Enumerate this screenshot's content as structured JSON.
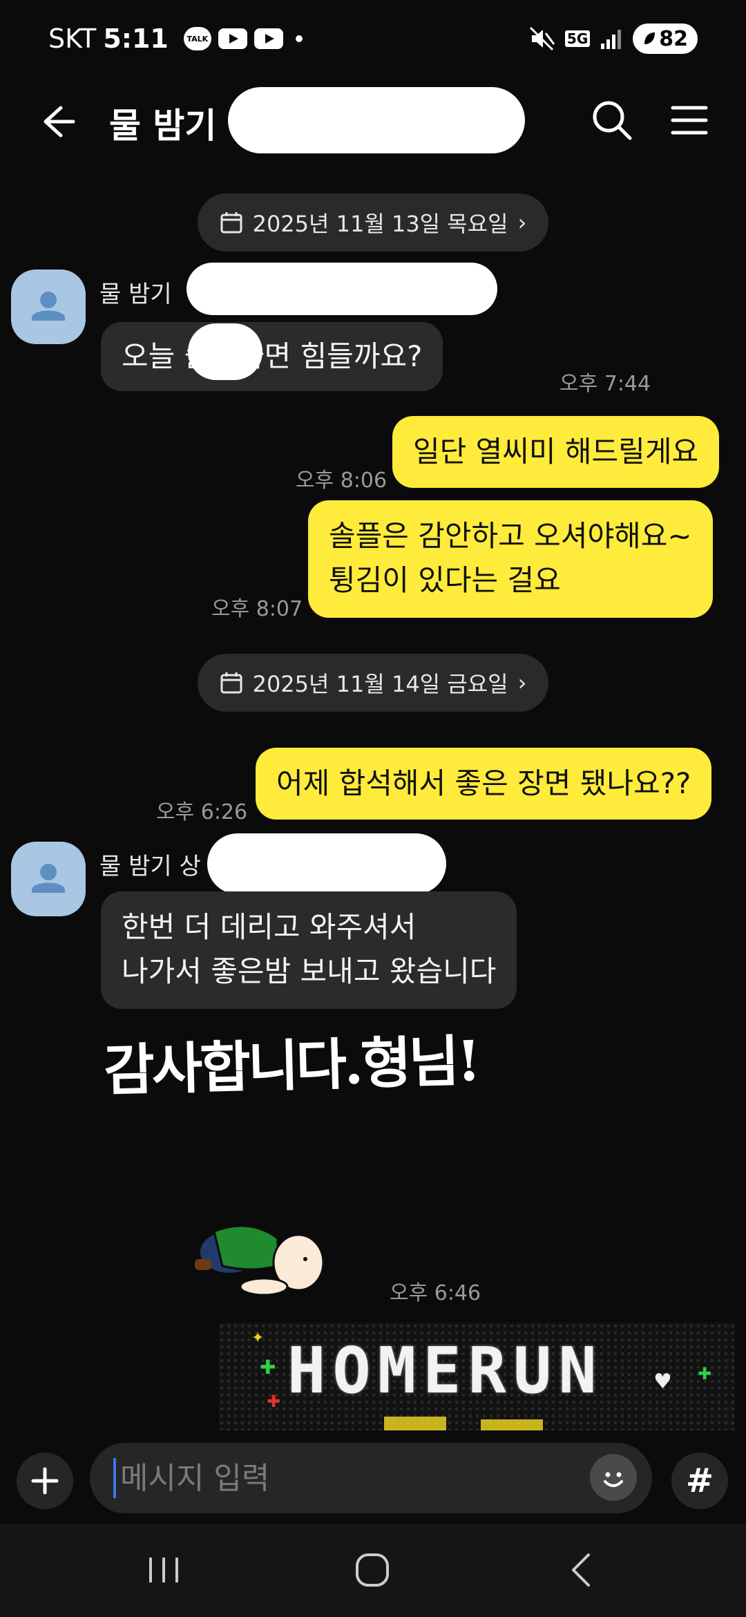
{
  "status_bar": {
    "carrier": "SKT",
    "time": "5:11",
    "talk_label": "TALK",
    "network": "5G",
    "battery": "82"
  },
  "header": {
    "title": "물 밤기"
  },
  "date_dividers": [
    "2025년 11월 13일 목요일",
    "2025년 11월 14일 금요일"
  ],
  "messages": [
    {
      "sender": "물 밤기",
      "text": "오늘      솔플가면 힘들까요?",
      "time": "오후 7:44"
    },
    {
      "text": "일단 열씨미 해드릴게요",
      "time": "오후 8:06"
    },
    {
      "lines": [
        "솔플은 감안하고 오셔야해요~",
        "튕김이 있다는 걸요"
      ],
      "time": "오후 8:07"
    },
    {
      "text": "어제 합석해서 좋은 장면 됐나요??",
      "time": "오후 6:26"
    },
    {
      "sender": "물 밤기 상",
      "lines": [
        "한번 더 데리고 와주셔서",
        "나가서 좋은밤 보내고 왔습니다"
      ]
    },
    {
      "sticker_text": "감사합니다.형님!",
      "time": "오후 6:46"
    }
  ],
  "banner": {
    "text": "HOMERUN"
  },
  "composer": {
    "placeholder": "메시지 입력",
    "hash_label": "#"
  },
  "colors": {
    "background": "#0b0b0b",
    "incoming_bubble": "#2b2b2b",
    "outgoing_bubble": "#ffeb3b",
    "avatar": "#a9c7e3"
  }
}
